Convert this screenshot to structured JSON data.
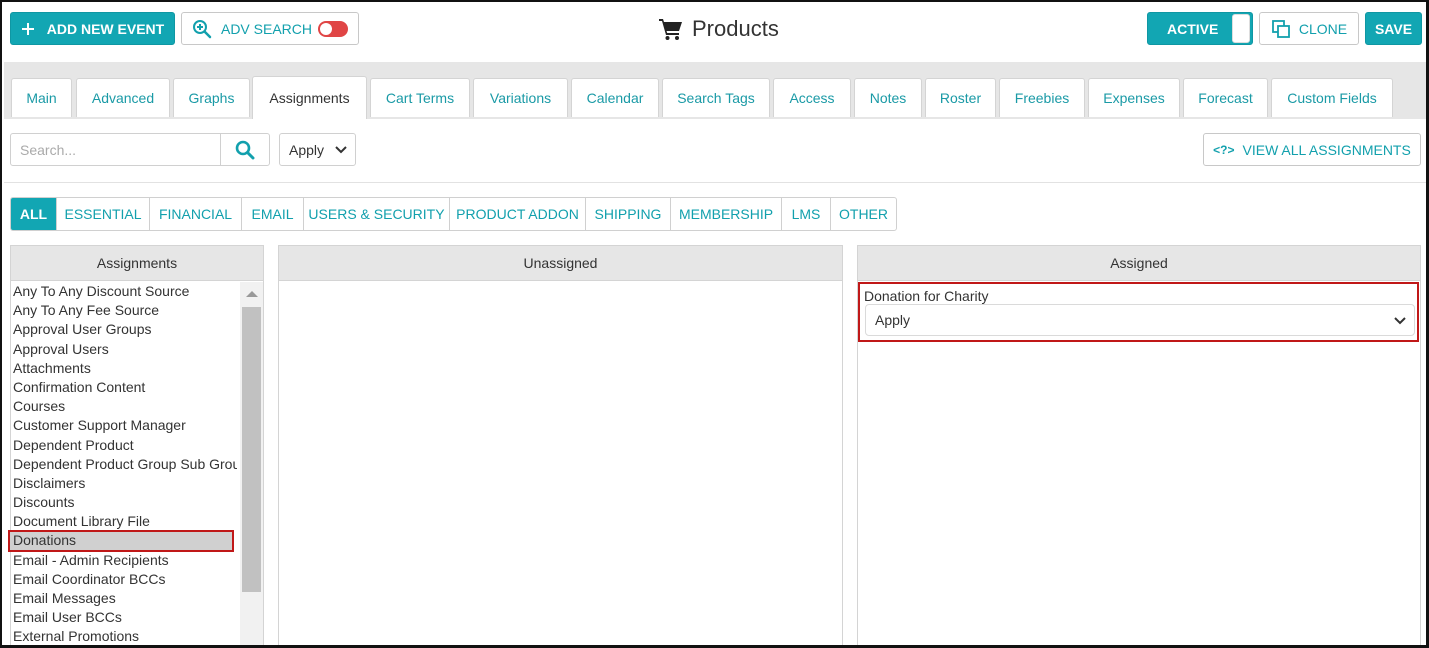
{
  "topbar": {
    "add_event_label": "ADD NEW EVENT",
    "adv_search_label": "ADV SEARCH",
    "page_title": "Products",
    "active_label": "ACTIVE",
    "clone_label": "CLONE",
    "save_label": "SAVE"
  },
  "tabs": [
    {
      "label": "Main"
    },
    {
      "label": "Advanced"
    },
    {
      "label": "Graphs"
    },
    {
      "label": "Assignments",
      "active": true
    },
    {
      "label": "Cart Terms"
    },
    {
      "label": "Variations"
    },
    {
      "label": "Calendar"
    },
    {
      "label": "Search Tags"
    },
    {
      "label": "Access"
    },
    {
      "label": "Notes"
    },
    {
      "label": "Roster"
    },
    {
      "label": "Freebies"
    },
    {
      "label": "Expenses"
    },
    {
      "label": "Forecast"
    },
    {
      "label": "Custom Fields"
    }
  ],
  "search": {
    "placeholder": "Search...",
    "apply_select": "Apply",
    "view_all_label": "VIEW ALL ASSIGNMENTS"
  },
  "categories": [
    {
      "label": "ALL",
      "active": true
    },
    {
      "label": "ESSENTIAL"
    },
    {
      "label": "FINANCIAL"
    },
    {
      "label": "EMAIL"
    },
    {
      "label": "USERS & SECURITY"
    },
    {
      "label": "PRODUCT ADDON"
    },
    {
      "label": "SHIPPING"
    },
    {
      "label": "MEMBERSHIP"
    },
    {
      "label": "LMS"
    },
    {
      "label": "OTHER"
    }
  ],
  "panels": {
    "assignments_title": "Assignments",
    "unassigned_title": "Unassigned",
    "assigned_title": "Assigned"
  },
  "assignment_items": [
    "Any To Any Discount Source",
    "Any To Any Fee Source",
    "Approval User Groups",
    "Approval Users",
    "Attachments",
    "Confirmation Content",
    "Courses",
    "Customer Support Manager",
    "Dependent Product",
    "Dependent Product Group Sub Grou",
    "Disclaimers",
    "Discounts",
    "Document Library File",
    "Donations",
    "Email - Admin Recipients",
    "Email Coordinator BCCs",
    "Email Messages",
    "Email User BCCs",
    "External Promotions"
  ],
  "selected_item": "Donations",
  "assigned": {
    "item_label": "Donation for Charity",
    "item_value": "Apply"
  },
  "colors": {
    "accent": "#12a6b3",
    "highlight_border": "#c01818",
    "toggle_off": "#e04545"
  }
}
